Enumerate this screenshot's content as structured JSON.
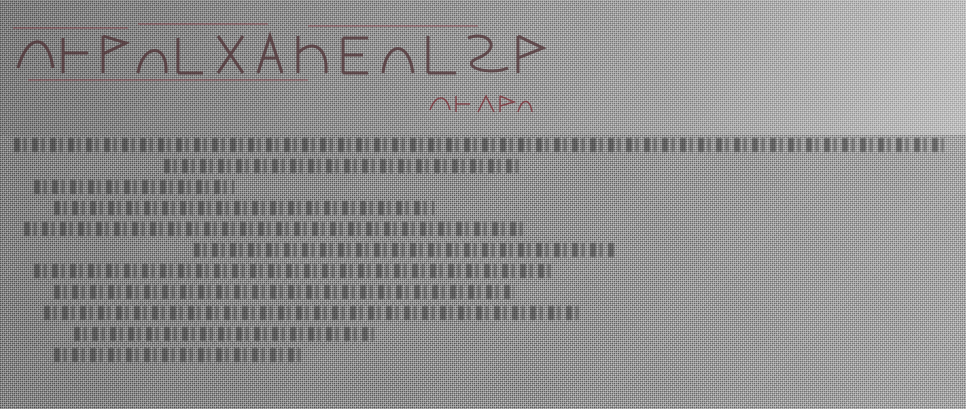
{
  "colors": {
    "background": "#909090",
    "title_accent": "#7a1a24",
    "text": "#2a2a2a"
  }
}
